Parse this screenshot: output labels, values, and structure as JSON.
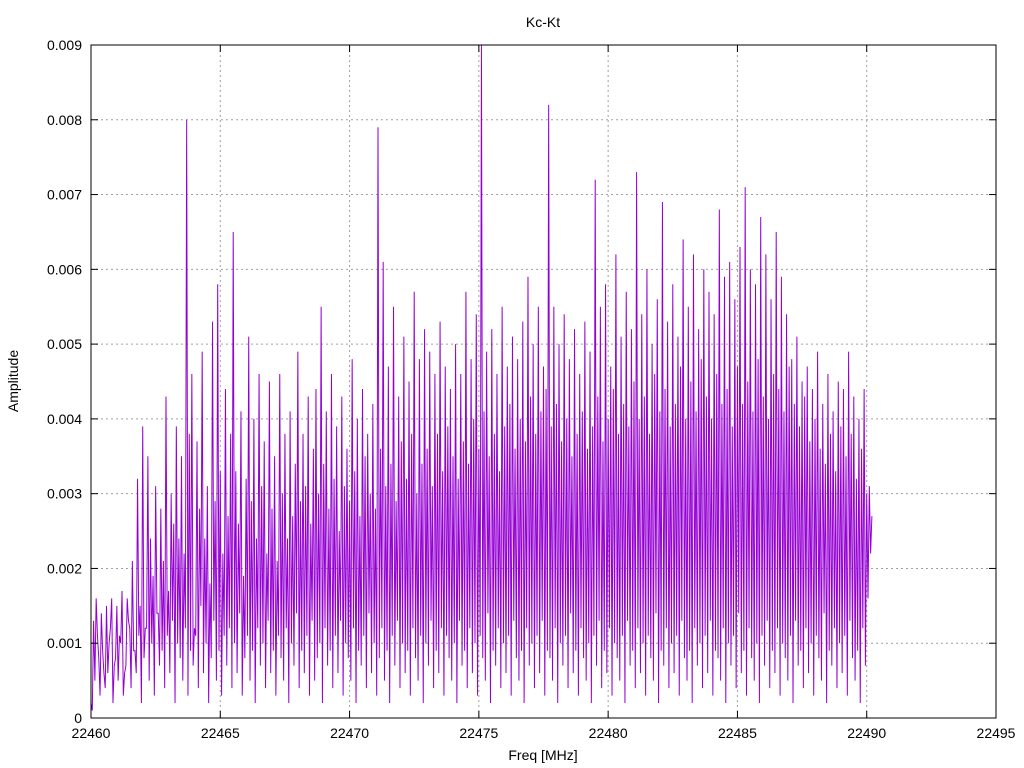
{
  "chart_data": {
    "type": "line",
    "title": "Kc-Kt",
    "xlabel": "Freq [MHz]",
    "ylabel": "Amplitude",
    "xlim": [
      22460,
      22495
    ],
    "ylim": [
      0,
      0.009
    ],
    "xticks": [
      22460,
      22465,
      22470,
      22475,
      22480,
      22485,
      22490,
      22495
    ],
    "yticks": [
      0,
      0.001,
      0.002,
      0.003,
      0.004,
      0.005,
      0.006,
      0.007,
      0.008,
      0.009
    ],
    "ytick_labels": [
      "0",
      "0.001",
      "0.002",
      "0.003",
      "0.004",
      "0.005",
      "0.006",
      "0.007",
      "0.008",
      "0.009"
    ],
    "grid": true,
    "line_color": "#9400d3",
    "series": [
      {
        "x_start": 22460.0,
        "x_step": 0.1,
        "values": [
          0.0002,
          0.0013,
          0.0016,
          0.0008,
          0.0014,
          0.0006,
          0.0015,
          0.001,
          0.0016,
          0.0007,
          0.0015,
          0.0011,
          0.0017,
          0.0006,
          0.0016,
          0.0012,
          0.0021,
          0.0009,
          0.0032,
          0.0015,
          0.0039,
          0.0012,
          0.0035,
          0.0024,
          0.0019,
          0.0031,
          0.0014,
          0.0028,
          0.0021,
          0.0043,
          0.0017,
          0.003,
          0.0026,
          0.0039,
          0.0024,
          0.0035,
          0.0022,
          0.008,
          0.0038,
          0.0046,
          0.0012,
          0.0037,
          0.0028,
          0.0049,
          0.0024,
          0.0031,
          0.0018,
          0.0053,
          0.0029,
          0.0058,
          0.0033,
          0.0022,
          0.0044,
          0.0027,
          0.0038,
          0.0065,
          0.0033,
          0.0026,
          0.0041,
          0.0019,
          0.0032,
          0.0051,
          0.0029,
          0.004,
          0.0024,
          0.0046,
          0.0031,
          0.0037,
          0.0022,
          0.0045,
          0.0028,
          0.0035,
          0.0021,
          0.0046,
          0.003,
          0.0038,
          0.0024,
          0.0041,
          0.0027,
          0.0034,
          0.0049,
          0.0029,
          0.0038,
          0.0031,
          0.0043,
          0.0026,
          0.0036,
          0.0044,
          0.003,
          0.0055,
          0.0034,
          0.0041,
          0.0028,
          0.0046,
          0.0032,
          0.0039,
          0.0025,
          0.0043,
          0.0031,
          0.0036,
          0.0029,
          0.0048,
          0.0033,
          0.004,
          0.0027,
          0.0044,
          0.0035,
          0.0038,
          0.003,
          0.0042,
          0.0028,
          0.0079,
          0.0036,
          0.0061,
          0.0031,
          0.0047,
          0.0034,
          0.0055,
          0.0029,
          0.0043,
          0.0037,
          0.0051,
          0.0032,
          0.0045,
          0.0038,
          0.0057,
          0.003,
          0.0048,
          0.0034,
          0.0052,
          0.0036,
          0.0049,
          0.0031,
          0.0046,
          0.0038,
          0.0053,
          0.0033,
          0.0047,
          0.0039,
          0.0044,
          0.0035,
          0.005,
          0.0032,
          0.0046,
          0.0037,
          0.0057,
          0.0034,
          0.0048,
          0.004,
          0.0054,
          0.0036,
          0.0095,
          0.0041,
          0.0049,
          0.0035,
          0.0052,
          0.0038,
          0.0046,
          0.0033,
          0.0055,
          0.0039,
          0.0047,
          0.0042,
          0.0051,
          0.0036,
          0.0048,
          0.004,
          0.0053,
          0.0037,
          0.0059,
          0.0043,
          0.005,
          0.0038,
          0.0055,
          0.0041,
          0.0047,
          0.0044,
          0.0082,
          0.0039,
          0.0055,
          0.0042,
          0.005,
          0.0037,
          0.0054,
          0.004,
          0.0048,
          0.0035,
          0.0052,
          0.0038,
          0.0046,
          0.0041,
          0.0053,
          0.0036,
          0.0049,
          0.0039,
          0.0072,
          0.0043,
          0.0055,
          0.0037,
          0.0058,
          0.004,
          0.0047,
          0.0044,
          0.0062,
          0.0038,
          0.0051,
          0.0042,
          0.0057,
          0.0039,
          0.0052,
          0.0045,
          0.0073,
          0.004,
          0.0054,
          0.0043,
          0.006,
          0.0038,
          0.005,
          0.0046,
          0.0056,
          0.0041,
          0.0069,
          0.0044,
          0.0053,
          0.0039,
          0.0058,
          0.0042,
          0.0051,
          0.0047,
          0.0064,
          0.004,
          0.0055,
          0.0045,
          0.0062,
          0.0041,
          0.0052,
          0.0048,
          0.006,
          0.0043,
          0.0057,
          0.004,
          0.0054,
          0.0046,
          0.0068,
          0.0042,
          0.0059,
          0.0044,
          0.0061,
          0.0039,
          0.0056,
          0.0047,
          0.0063,
          0.0042,
          0.0071,
          0.0045,
          0.006,
          0.0041,
          0.0058,
          0.0048,
          0.0067,
          0.0043,
          0.0062,
          0.004,
          0.0056,
          0.0046,
          0.0065,
          0.0044,
          0.0059,
          0.0041,
          0.0054,
          0.0047,
          0.0048,
          0.0042,
          0.0051,
          0.0039,
          0.0045,
          0.0043,
          0.0047,
          0.0037,
          0.0044,
          0.004,
          0.0049,
          0.0036,
          0.0042,
          0.0034,
          0.0046,
          0.0038,
          0.0041,
          0.0033,
          0.0045,
          0.0039,
          0.0044,
          0.0035,
          0.0049,
          0.0038,
          0.0043,
          0.0032,
          0.004,
          0.0036,
          0.0044,
          0.003,
          0.0031,
          0.0027
        ]
      }
    ],
    "troughs": [
      0.0001,
      0.0005,
      0.0011,
      0.0003,
      0.0009,
      0.0004,
      0.0006,
      0.0012,
      0.0002,
      0.0008,
      0.0005,
      0.001,
      0.0003,
      0.0007,
      0.0013,
      0.0004,
      0.0009,
      0.0006,
      0.0011,
      0.0002,
      0.0008,
      0.0012,
      0.0005,
      0.001,
      0.0003,
      0.0014,
      0.0007,
      0.0009,
      0.0004,
      0.0011,
      0.0006,
      0.0013,
      0.0002,
      0.001,
      0.0008,
      0.0005,
      0.0012,
      0.0003,
      0.0009,
      0.0007,
      0.0011,
      0.0004,
      0.0015,
      0.0006,
      0.001,
      0.0002,
      0.0008,
      0.0013,
      0.0005,
      0.0009,
      0.0003,
      0.0011,
      0.0007,
      0.0012,
      0.0004,
      0.001,
      0.0006,
      0.0014,
      0.0003,
      0.0008,
      0.0011,
      0.0005,
      0.0009,
      0.0002,
      0.0012,
      0.0007,
      0.001,
      0.0004,
      0.0013,
      0.0006,
      0.0009,
      0.0003,
      0.0011,
      0.0008,
      0.0005,
      0.0012,
      0.0002,
      0.001,
      0.0007,
      0.0014,
      0.0004,
      0.0009,
      0.0006,
      0.0011,
      0.0003,
      0.0013,
      0.0005,
      0.0008,
      0.001,
      0.0002,
      0.0012,
      0.0007,
      0.0009,
      0.0004,
      0.0011,
      0.0006,
      0.0013,
      0.0003,
      0.001,
      0.0008,
      0.0005,
      0.0012,
      0.0002,
      0.0009,
      0.0007,
      0.0011,
      0.0004,
      0.0014,
      0.0006,
      0.001,
      0.0003,
      0.0008,
      0.0012,
      0.0005,
      0.0009,
      0.0002,
      0.0011,
      0.0007,
      0.0013,
      0.0004,
      0.001,
      0.0006,
      0.0009,
      0.0003,
      0.0012,
      0.0008,
      0.0005,
      0.0011,
      0.0002,
      0.001,
      0.0007,
      0.0013,
      0.0004,
      0.0009,
      0.0006,
      0.0012,
      0.0003,
      0.0011,
      0.0008,
      0.0005,
      0.001,
      0.0002,
      0.0013,
      0.0007,
      0.0009,
      0.0004,
      0.0012,
      0.0006,
      0.001,
      0.0003,
      0.0011,
      0.0008,
      0.0005,
      0.0014,
      0.0002,
      0.0009,
      0.0007,
      0.0012,
      0.0004,
      0.001,
      0.0006,
      0.0011,
      0.0003,
      0.0013,
      0.0008,
      0.0005,
      0.0009,
      0.0002,
      0.0012,
      0.0007,
      0.001,
      0.0004,
      0.0011,
      0.0006,
      0.0013,
      0.0003,
      0.0009,
      0.0008,
      0.0005,
      0.0012,
      0.0002,
      0.001,
      0.0007,
      0.0011,
      0.0004,
      0.0014,
      0.0006,
      0.0009,
      0.0003,
      0.0012,
      0.0008,
      0.0005,
      0.001,
      0.0002,
      0.0011,
      0.0007,
      0.0013,
      0.0004,
      0.0009,
      0.0006,
      0.0012,
      0.0003,
      0.001,
      0.0008,
      0.0005,
      0.0011,
      0.0002,
      0.0013,
      0.0007,
      0.0009,
      0.0004,
      0.0012,
      0.0006,
      0.001,
      0.0003,
      0.0011,
      0.0008,
      0.0005,
      0.0014,
      0.0002,
      0.0009,
      0.0007,
      0.0012,
      0.0004,
      0.001,
      0.0006,
      0.0011,
      0.0003,
      0.0013,
      0.0008,
      0.0005,
      0.0009,
      0.0002,
      0.0012,
      0.0007,
      0.001,
      0.0004,
      0.0011,
      0.0006,
      0.0013,
      0.0003,
      0.0009,
      0.0008,
      0.0005,
      0.0012,
      0.0002,
      0.001,
      0.0007,
      0.0011,
      0.0004,
      0.0014,
      0.0006,
      0.0009,
      0.0003,
      0.0012,
      0.0008,
      0.0005,
      0.001,
      0.0002,
      0.0011,
      0.0007,
      0.0013,
      0.0004,
      0.0009,
      0.0006,
      0.0012,
      0.0003,
      0.001,
      0.0008,
      0.0005,
      0.0011,
      0.0002,
      0.0013,
      0.0007,
      0.0009,
      0.0004,
      0.0012,
      0.0006,
      0.001,
      0.0003,
      0.0011,
      0.0008,
      0.0005,
      0.0014,
      0.0002,
      0.0009,
      0.0007,
      0.0012,
      0.0004,
      0.001,
      0.0006,
      0.0011,
      0.0003,
      0.0013,
      0.0008,
      0.0005,
      0.0009,
      0.0002,
      0.0012,
      0.0007,
      0.0016,
      0.0022,
      0.0026
    ]
  }
}
